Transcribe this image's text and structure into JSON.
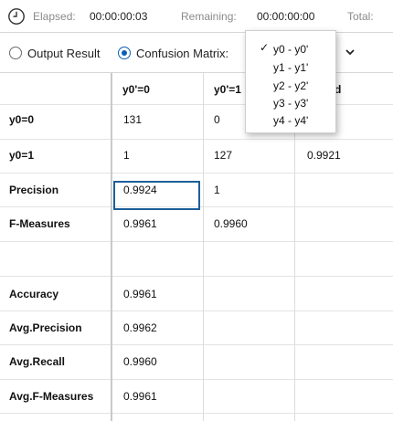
{
  "status_bar": {
    "elapsed_label": "Elapsed:",
    "elapsed_value": "00:00:00:03",
    "remaining_label": "Remaining:",
    "remaining_value": "00:00:00:00",
    "total_label": "Total:",
    "icon": "clock-icon"
  },
  "options": {
    "output_result_label": "Output Result",
    "output_result_selected": false,
    "confusion_matrix_label": "Confusion Matrix:",
    "confusion_matrix_selected": true,
    "accent_color": "#0a5fb4"
  },
  "dropdown": {
    "items": [
      "y0 - y0'",
      "y1 - y1'",
      "y2 - y2'",
      "y3 - y3'",
      "y4 - y4'"
    ],
    "selected_index": 0
  },
  "table": {
    "columns": [
      "y0'=0",
      "y0'=1",
      "d"
    ],
    "rows": [
      {
        "label": "y0=0",
        "cells": [
          "131",
          "0",
          ""
        ]
      },
      {
        "label": "y0=1",
        "cells": [
          "1",
          "127",
          "0.9921"
        ]
      },
      {
        "label": "Precision",
        "cells": [
          "0.9924",
          "1",
          ""
        ]
      },
      {
        "label": "F-Measures",
        "cells": [
          "0.9961",
          "0.9960",
          ""
        ]
      },
      {
        "label": "",
        "cells": [
          "",
          "",
          ""
        ]
      },
      {
        "label": "Accuracy",
        "cells": [
          "0.9961",
          "",
          ""
        ]
      },
      {
        "label": "Avg.Precision",
        "cells": [
          "0.9962",
          "",
          ""
        ]
      },
      {
        "label": "Avg.Recall",
        "cells": [
          "0.9960",
          "",
          ""
        ]
      },
      {
        "label": "Avg.F-Measures",
        "cells": [
          "0.9961",
          "",
          ""
        ]
      }
    ],
    "selected_cell": {
      "row": 0,
      "col": 0
    },
    "selection_color": "#1d5f99"
  }
}
